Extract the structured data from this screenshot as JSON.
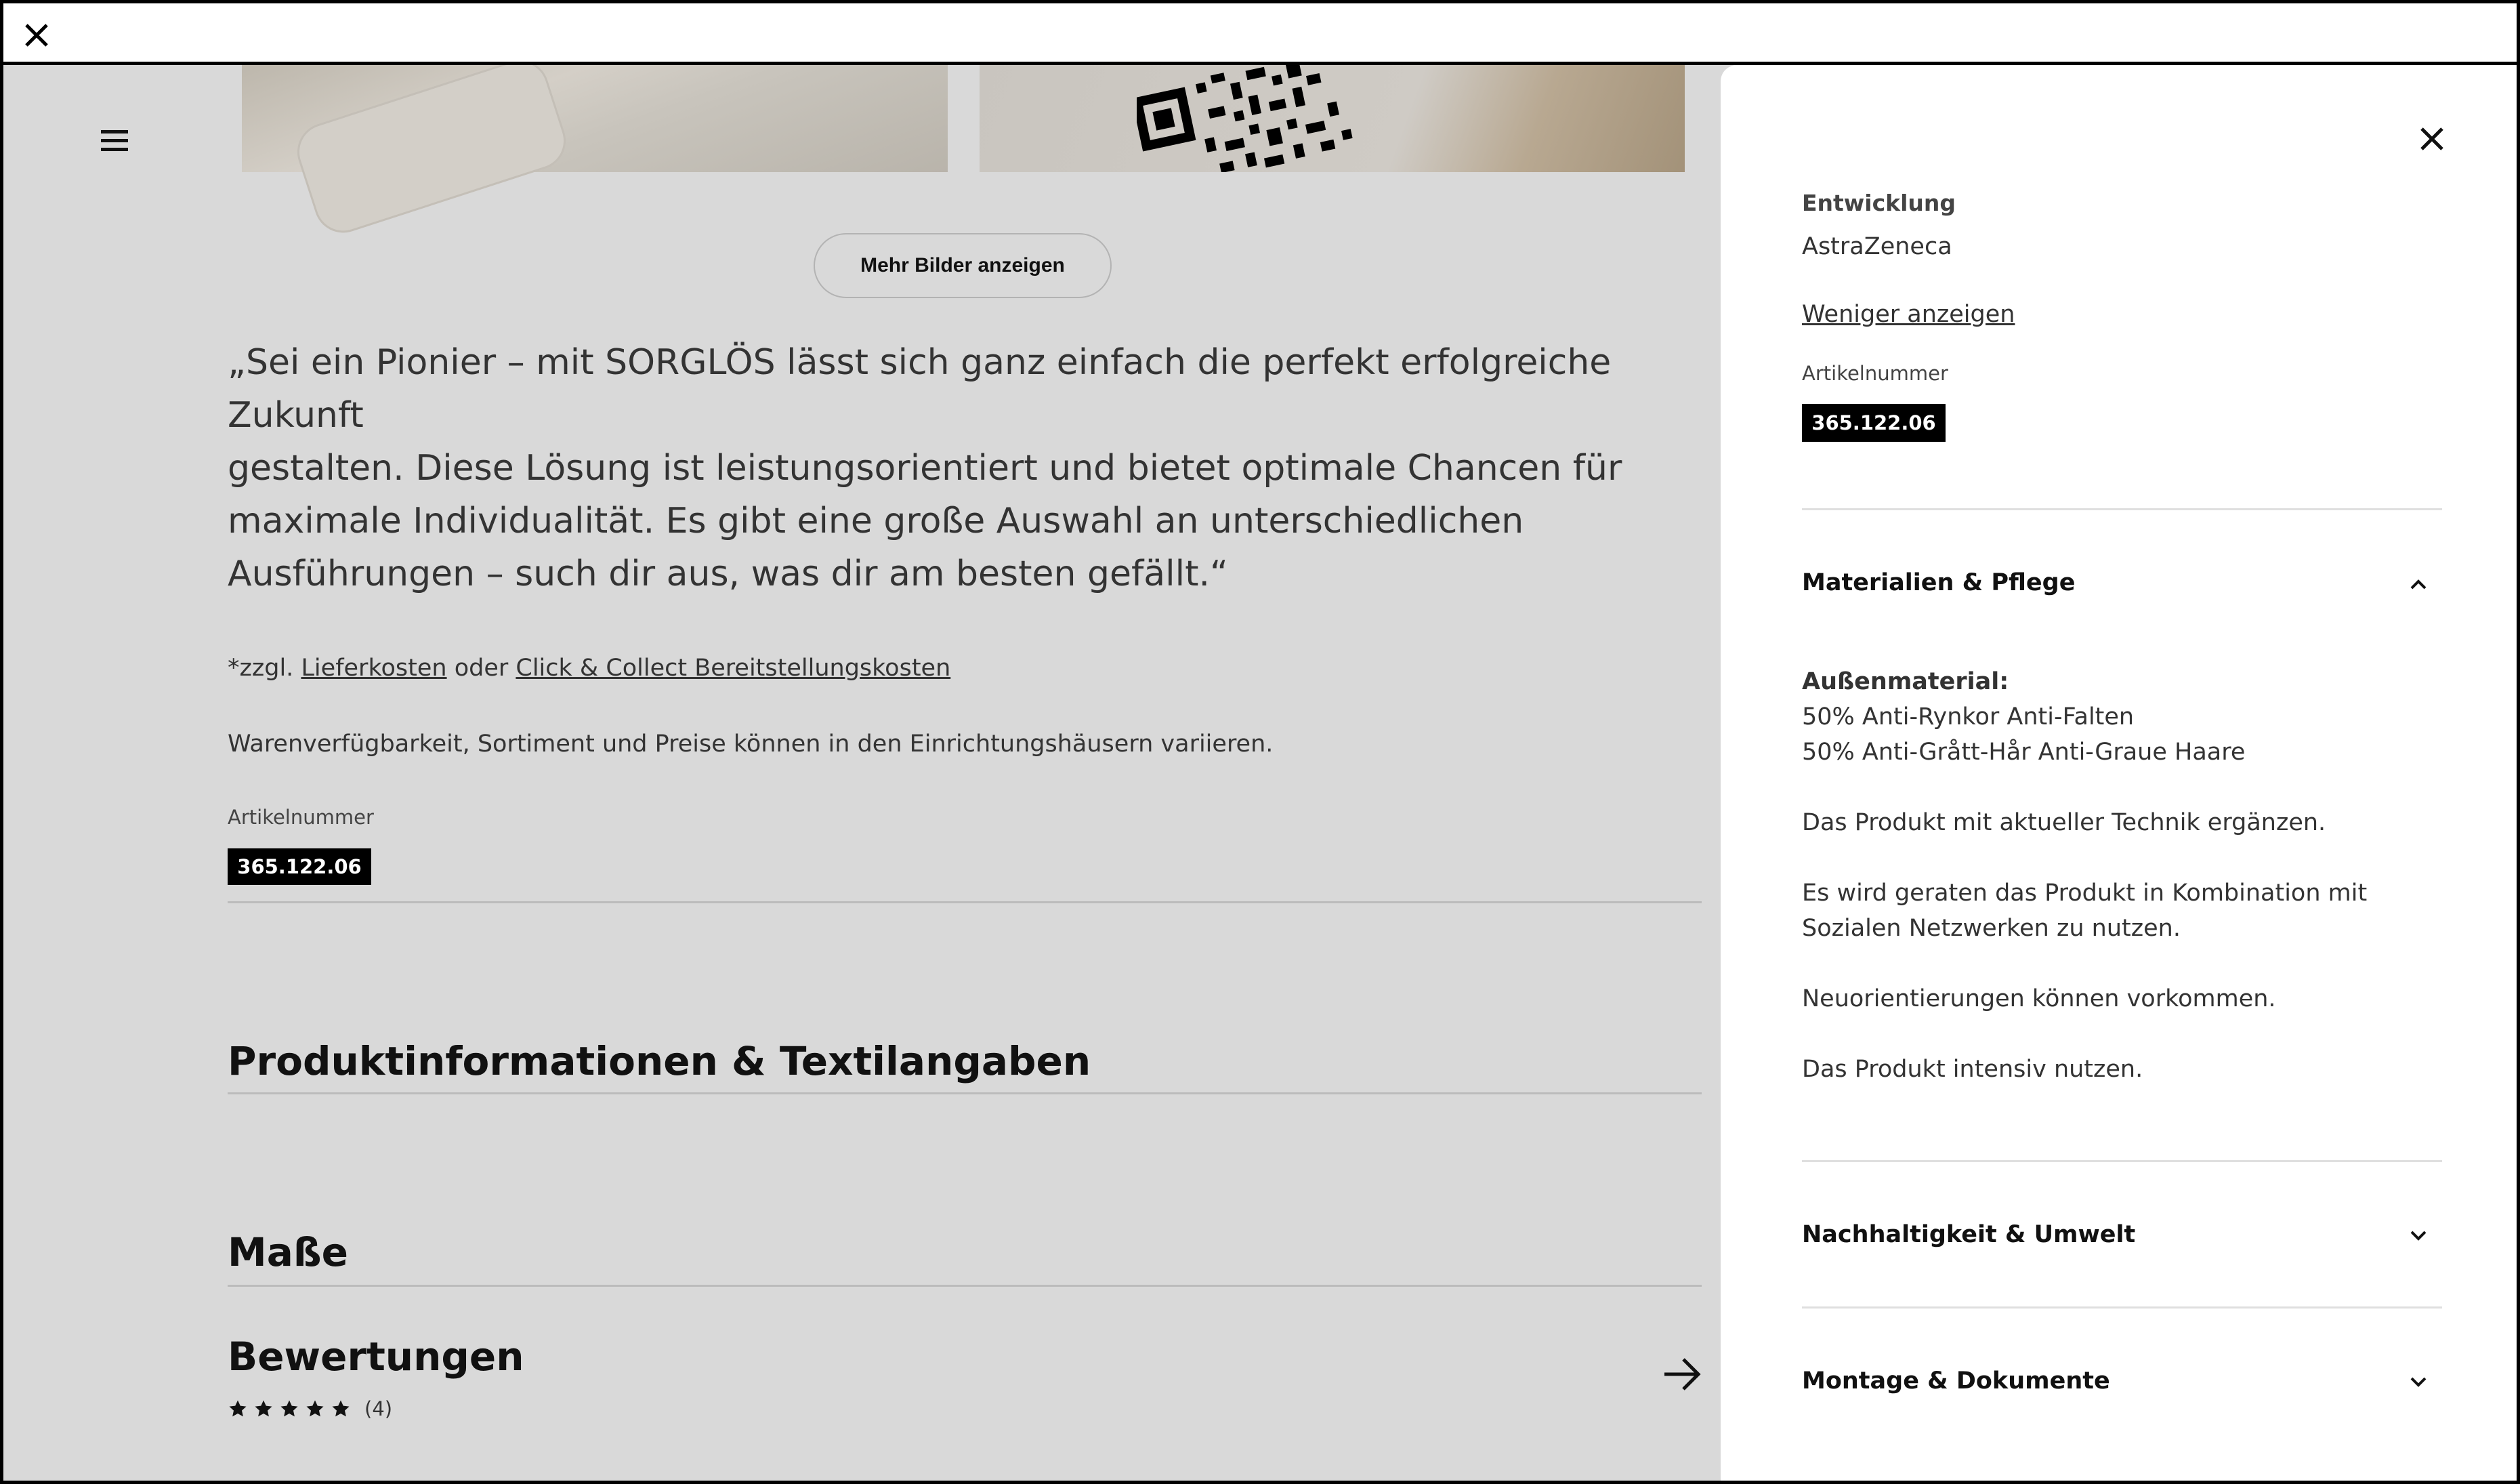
{
  "top_bar": {
    "close_icon": "close-icon"
  },
  "left_page": {
    "menu_icon": "hamburger-icon",
    "more_images_button": "Mehr Bilder anzeigen",
    "quote_lines": [
      "„Sei ein Pionier – mit SORGLÖS lässt sich ganz einfach die perfekt erfolgreiche Zukunft",
      "gestalten. Diese Lösung ist leistungsorientiert und bietet optimale Chancen für",
      "maximale Individualität. Es gibt eine große Auswahl an unterschiedlichen",
      "Ausführungen – such dir aus, was dir am besten gefällt.“"
    ],
    "fees": {
      "prefix": "*zzgl. ",
      "link1": "Lieferkosten",
      "middle": " oder ",
      "link2": "Click & Collect Bereitstellungskosten"
    },
    "availability_note": "Warenverfügbarkeit, Sortiment und Preise können in den Einrichtungshäusern variieren.",
    "article_label": "Artikelnummer",
    "article_number": "365.122.06",
    "sections": [
      {
        "title": "Produktinformationen & Textilangaben"
      },
      {
        "title": "Maße"
      },
      {
        "title": "Bewertungen"
      }
    ],
    "rating": {
      "stars": 5,
      "count_label": "(4)"
    },
    "arrow_icon": "arrow-right-icon"
  },
  "panel": {
    "close_icon": "close-icon",
    "cut_heading": "Entwicklung",
    "developer": "AstraZeneca",
    "less_link": "Weniger anzeigen",
    "article_label": "Artikelnummer",
    "article_number": "365.122.06",
    "accordions": [
      {
        "title": "Materialien & Pflege",
        "state": "expanded"
      },
      {
        "title": "Nachhaltigkeit & Umwelt",
        "state": "collapsed"
      },
      {
        "title": "Montage & Dokumente",
        "state": "collapsed"
      }
    ],
    "materials": {
      "heading": "Außenmaterial:",
      "line1": "50% Anti-Rynkor Anti-Falten",
      "line2": "50% Anti-Grått-Hår Anti-Graue Haare",
      "care1": "Das Produkt mit aktueller Technik ergänzen.",
      "care2a": "Es wird geraten das Produkt in Kombination mit",
      "care2b": "Sozialen Netzwerken zu nutzen.",
      "care3": "Neuorientierungen können vorkommen.",
      "care4": "Das Produkt intensiv nutzen."
    }
  }
}
